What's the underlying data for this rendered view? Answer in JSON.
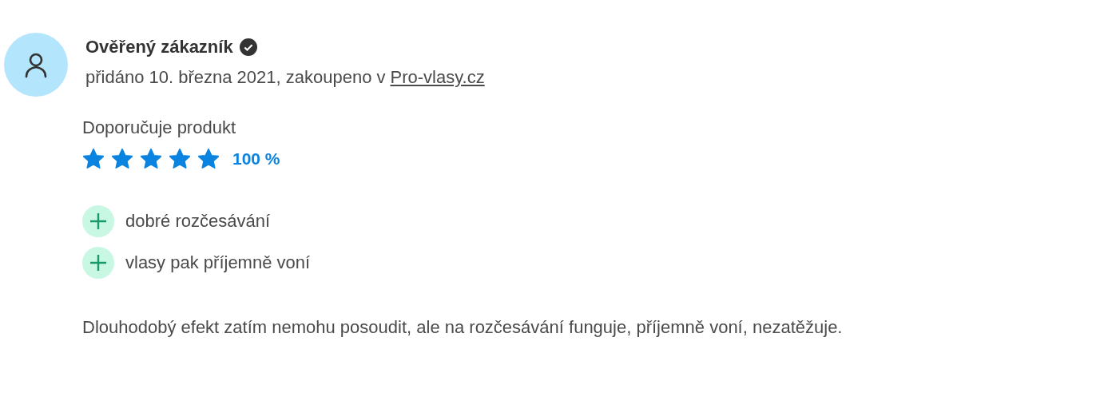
{
  "review": {
    "author": "Ověřený zákazník",
    "verified": true,
    "meta": "přidáno 10. března 2021, zakoupeno v",
    "shop_link": "Pro-vlasy.cz",
    "recommendation": "Doporučuje produkt",
    "stars": 5,
    "score": "100 %",
    "points": [
      {
        "kind": "pro",
        "text": "dobré rozčesávání"
      },
      {
        "kind": "pro",
        "text": "vlasy pak příjemně voní"
      }
    ],
    "text": "Dlouhodobý efekt zatím nemohu posoudit, ale na rozčesávání funguje, příjemně voní, nezatěžuje."
  }
}
